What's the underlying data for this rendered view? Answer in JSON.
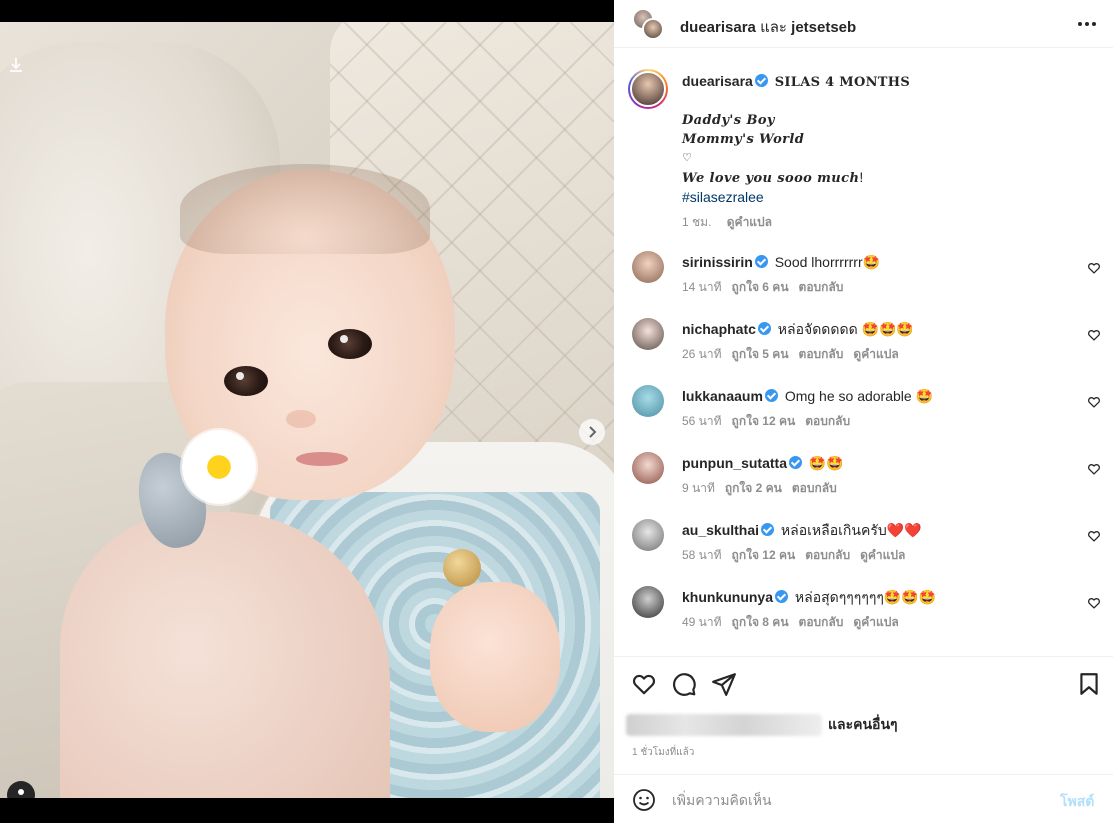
{
  "header": {
    "user1": "duearisara",
    "joiner": "และ",
    "user2": "jetsetseb"
  },
  "caption": {
    "username": "duearisara",
    "title": "SILAS 4 MONTHS",
    "line1": "Daddy's Boy",
    "line2": "Mommy's World",
    "heart": "♡",
    "line3": "We love you sooo much",
    "line3_end": "!",
    "hashtag": "#silasezralee",
    "time": "1 ชม.",
    "translate": "ดูคำแปล"
  },
  "comments": [
    {
      "username": "sirinissirin",
      "text": "Sood lhorrrrrrr🤩",
      "time": "14 นาที",
      "likes": "ถูกใจ 6 คน",
      "reply": "ตอบกลับ",
      "translate": ""
    },
    {
      "username": "nichaphatc",
      "text": "หล่อจัดดดดด 🤩🤩🤩",
      "time": "26 นาที",
      "likes": "ถูกใจ 5 คน",
      "reply": "ตอบกลับ",
      "translate": "ดูคำแปล"
    },
    {
      "username": "lukkanaaum",
      "text": "Omg he so adorable 🤩",
      "time": "56 นาที",
      "likes": "ถูกใจ 12 คน",
      "reply": "ตอบกลับ",
      "translate": ""
    },
    {
      "username": "punpun_sutatta",
      "text": "🤩🤩",
      "time": "9 นาที",
      "likes": "ถูกใจ 2 คน",
      "reply": "ตอบกลับ",
      "translate": ""
    },
    {
      "username": "au_skulthai",
      "text": "หล่อเหลือเกินครับ❤️❤️",
      "time": "58 นาที",
      "likes": "ถูกใจ 12 คน",
      "reply": "ตอบกลับ",
      "translate": "ดูคำแปล"
    },
    {
      "username": "khunkununya",
      "text": "หล่อสุดๆๆๆๆๆๆ🤩🤩🤩",
      "time": "49 นาที",
      "likes": "ถูกใจ 8 คน",
      "reply": "ตอบกลับ",
      "translate": "ดูคำแปล"
    }
  ],
  "likes": {
    "others": "และคนอื่นๆ",
    "time_ago": "1 ชั่วโมงที่แล้ว"
  },
  "comment_box": {
    "placeholder": "เพิ่มความคิดเห็น",
    "post_label": "โพสต์"
  },
  "carousel": {
    "total_slides": 10,
    "active_slide": 1
  },
  "colors": {
    "verified": "#3897f0",
    "hashtag": "#00376b",
    "post_disabled": "#b2dffc"
  },
  "icons": [
    "download-icon",
    "next-arrow-icon",
    "user-tag-icon",
    "more-options-icon",
    "verified-icon",
    "heart-icon",
    "comment-icon",
    "share-icon",
    "save-icon",
    "emoji-icon"
  ]
}
